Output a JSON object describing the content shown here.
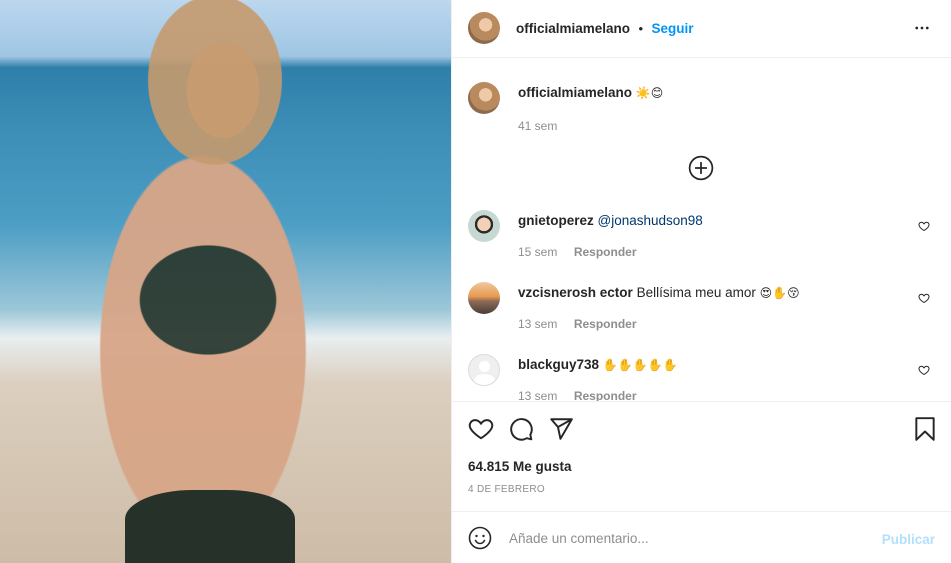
{
  "post": {
    "photo_alt": "foto",
    "owner": "officialmiamelano",
    "follow_label": "Seguir",
    "separator": "•"
  },
  "caption": {
    "username": "officialmiamelano",
    "emojis": "☀️😊",
    "time": "41 sem"
  },
  "comments": [
    {
      "username": "gnietoperez",
      "text": "@jonashudson98",
      "time": "15 sem",
      "reply": "Responder"
    },
    {
      "username": "vzcisnerosh ector",
      "text": "Bellísima meu amor",
      "emojis": "😍✋😚",
      "time": "13 sem",
      "reply": "Responder"
    },
    {
      "username": "blackguy738",
      "text": "",
      "emojis": "✋✋✋✋✋",
      "time": "13 sem",
      "reply": "Responder"
    }
  ],
  "likes": "64.815 Me gusta",
  "date": "4 DE FEBRERO",
  "composer": {
    "placeholder": "Añade un comentario...",
    "publish_label": "Publicar"
  },
  "colors": {
    "accent": "#0095f6",
    "publish_disabled": "#b2dffc",
    "muted": "#8e8e8e",
    "border": "#efefef"
  }
}
